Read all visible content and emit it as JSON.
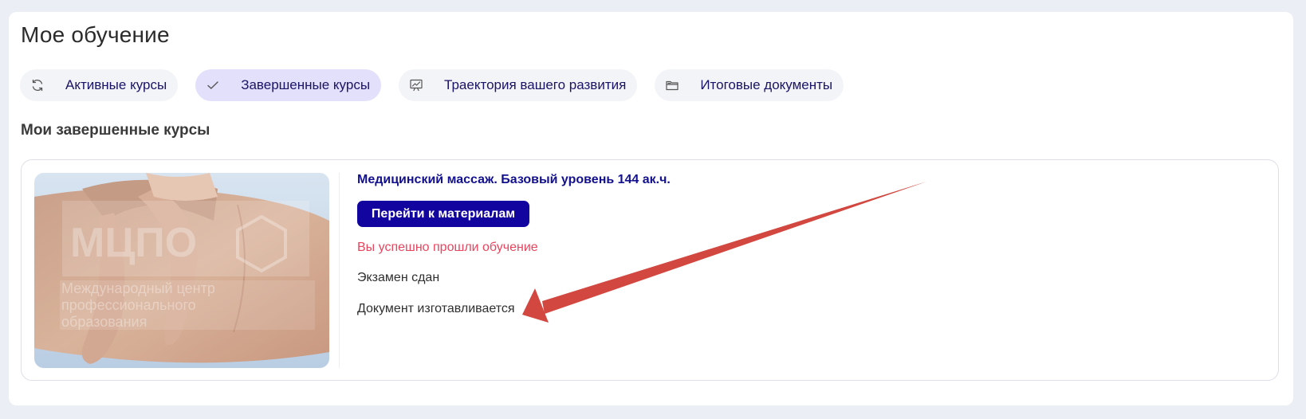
{
  "page": {
    "title": "Мое обучение",
    "section_title": "Мои завершенные курсы"
  },
  "tabs": [
    {
      "label": "Активные курсы",
      "icon": "refresh-icon",
      "active": false
    },
    {
      "label": "Завершенные курсы",
      "icon": "check-icon",
      "active": true
    },
    {
      "label": "Траектория вашего развития",
      "icon": "chart-board-icon",
      "active": false
    },
    {
      "label": "Итоговые документы",
      "icon": "folder-icon",
      "active": false
    }
  ],
  "course": {
    "title": "Медицинский массаж. Базовый уровень 144 ак.ч.",
    "button_label": "Перейти к материалам",
    "status_success": "Вы успешно прошли обучение",
    "exam_status": "Экзамен сдан",
    "document_status": "Документ изготавливается",
    "image": {
      "watermark_logo": "МЦПО",
      "watermark_text": "Международный центр профессионального образования"
    }
  },
  "colors": {
    "accent": "#12049e",
    "title_blue": "#12108f",
    "success_red": "#e8455e",
    "active_tab": "#e3e0fb",
    "annotation_arrow": "#d2473f"
  }
}
